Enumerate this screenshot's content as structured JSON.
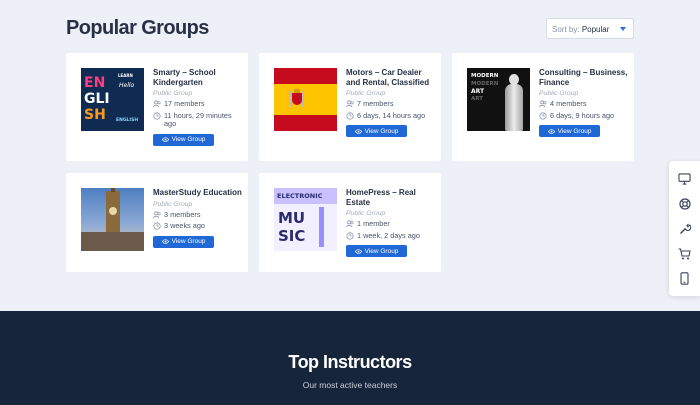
{
  "page_title": "Popular Groups",
  "sort": {
    "prefix": "Sort by:",
    "value": "Popular"
  },
  "groups": [
    {
      "name": "Smarty – School Kindergarten",
      "type": "Public Group",
      "members": "17 members",
      "activity": "11 hours, 29 minutes ago",
      "button": "View Group",
      "thumb_text": [
        "LEARN",
        "EN",
        "GLI",
        "SH",
        "ENGLISH",
        "Hello"
      ]
    },
    {
      "name": "Motors – Car Dealer and Rental, Classified",
      "type": "Public Group",
      "members": "7 members",
      "activity": "6 days, 14 hours ago",
      "button": "View Group"
    },
    {
      "name": "Consulting – Business, Finance",
      "type": "Public Group",
      "members": "4 members",
      "activity": "6 days, 9 hours ago",
      "button": "View Group",
      "thumb_text": [
        "MODERN",
        "MODERN",
        "ART",
        "ART"
      ]
    },
    {
      "name": "MasterStudy Education",
      "type": "Public Group",
      "members": "3 members",
      "activity": "3 weeks ago",
      "button": "View Group"
    },
    {
      "name": "HomePress – Real Estate",
      "type": "Public Group",
      "members": "1 member",
      "activity": "1 week, 2 days ago",
      "button": "View Group",
      "thumb_text": [
        "ELECTRONIC",
        "MU",
        "SIC"
      ]
    }
  ],
  "dock_icons": [
    "monitor-icon",
    "lifebuoy-icon",
    "wrench-icon",
    "cart-icon",
    "mobile-icon"
  ],
  "footer": {
    "title": "Top Instructors",
    "subtitle": "Our most active teachers"
  },
  "colors": {
    "accent": "#1f68d6",
    "footer_bg": "#17253a",
    "page_bg": "#eef0f7"
  }
}
